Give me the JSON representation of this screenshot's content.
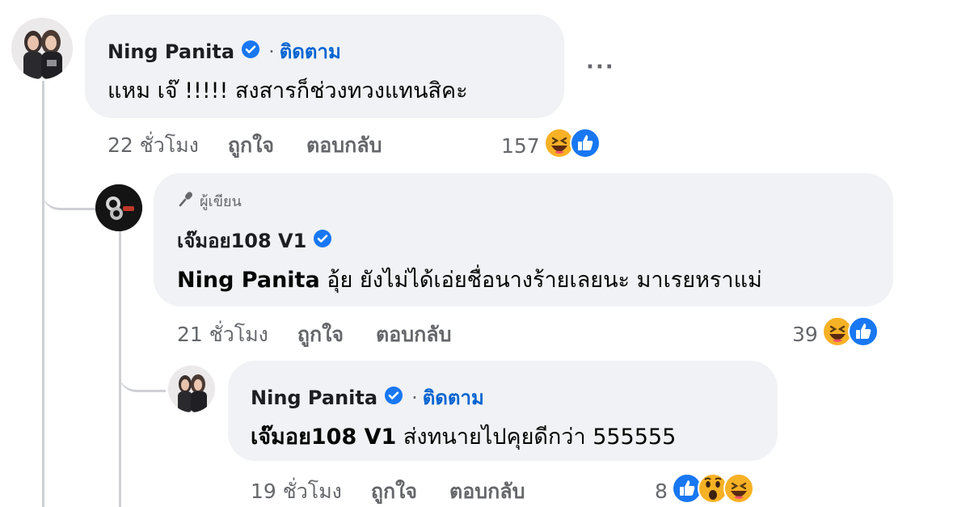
{
  "comments": [
    {
      "name": "Ning Panita",
      "dot": "·",
      "follow": "ติดตาม",
      "text": "แหม เจ๊ !!!!! สงสารก็ช่วงทวงแทนสิคะ",
      "time": "22 ชั่วโมง",
      "like": "ถูกใจ",
      "reply": "ตอบกลับ",
      "reaction_count": "157",
      "reactions": [
        "haha",
        "like"
      ],
      "more": "···"
    },
    {
      "badge": "ผู้เขียน",
      "name": "เจ๊มอย108 V1",
      "mention": "Ning Panita",
      "text": " อุ้ย ยังไม่ได้เอ่ยชื่อนางร้ายเลยนะ มาเรยหราแม่",
      "time": "21 ชั่วโมง",
      "like": "ถูกใจ",
      "reply": "ตอบกลับ",
      "reaction_count": "39",
      "reactions": [
        "haha",
        "like"
      ]
    },
    {
      "name": "Ning Panita",
      "dot": "·",
      "follow": "ติดตาม",
      "mention": "เจ๊มอย108 V1",
      "text": " ส่งทนายไปคุยดีกว่า 555555",
      "time": "19 ชั่วโมง",
      "like": "ถูกใจ",
      "reply": "ตอบกลับ",
      "reaction_count": "8",
      "reactions": [
        "like",
        "wow",
        "haha"
      ]
    }
  ],
  "colors": {
    "link": "#0064d1",
    "like_blue": "#1877f2",
    "bubble": "#f0f2f5",
    "meta": "#65676b",
    "emoji_yellow": "#f7b125"
  }
}
